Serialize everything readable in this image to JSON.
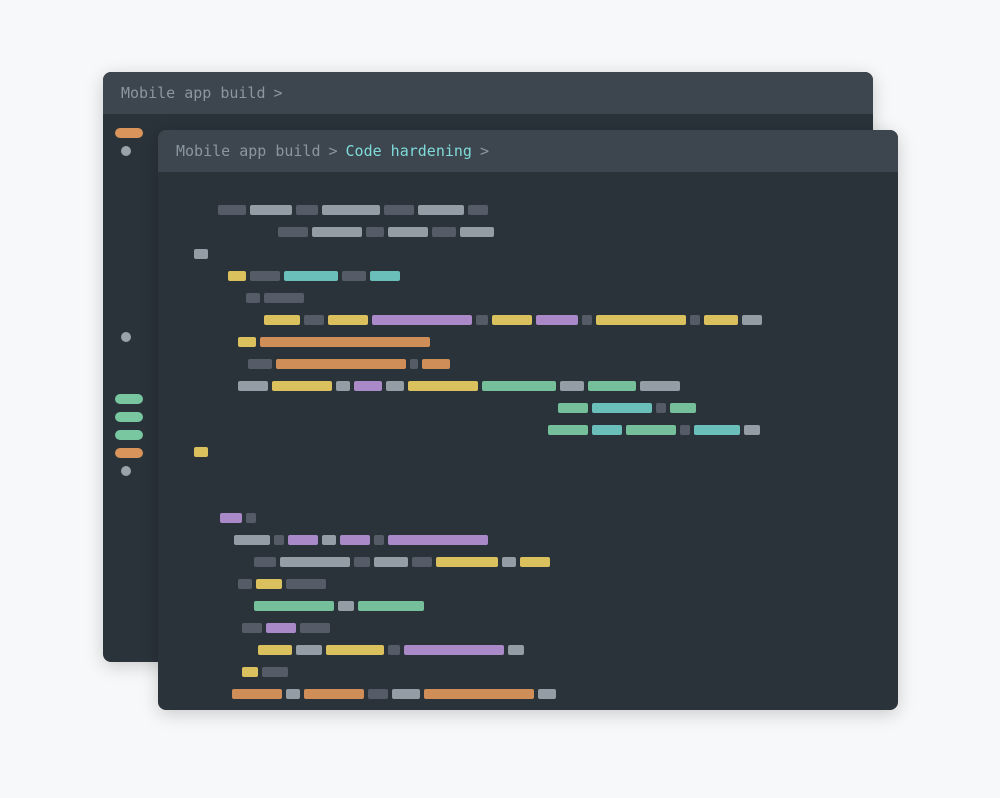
{
  "back_window": {
    "breadcrumb": [
      {
        "label": "Mobile app build",
        "active": false
      }
    ],
    "gutter": [
      {
        "kind": "pill",
        "color": "c-orange"
      },
      {
        "kind": "dot",
        "color": "c-lgray"
      },
      {
        "kind": "gap",
        "h": 160
      },
      {
        "kind": "dot",
        "color": "c-lgray"
      },
      {
        "kind": "gap",
        "h": 36
      },
      {
        "kind": "pill",
        "color": "c-green"
      },
      {
        "kind": "pill",
        "color": "c-green"
      },
      {
        "kind": "pill",
        "color": "c-green"
      },
      {
        "kind": "pill",
        "color": "c-orange"
      },
      {
        "kind": "dot",
        "color": "c-lgray"
      }
    ]
  },
  "front_window": {
    "breadcrumb": [
      {
        "label": "Mobile app build",
        "active": false
      },
      {
        "label": "Code hardening",
        "active": true
      }
    ],
    "code_rows": [
      {
        "indent": 20,
        "tokens": [
          [
            "c-gray",
            28
          ],
          [
            "c-lgray",
            42
          ],
          [
            "c-gray",
            22
          ],
          [
            "c-lgray",
            58
          ],
          [
            "c-gray",
            30
          ],
          [
            "c-lgray",
            46
          ],
          [
            "c-gray",
            20
          ]
        ]
      },
      {
        "indent": 80,
        "tokens": [
          [
            "c-gray",
            30
          ],
          [
            "c-lgray",
            50
          ],
          [
            "c-gray",
            18
          ],
          [
            "c-lgray",
            40
          ],
          [
            "c-gray",
            24
          ],
          [
            "c-lgray",
            34
          ]
        ]
      },
      {
        "indent": 0,
        "tokens": [
          [
            "c-lgray",
            14
          ]
        ]
      },
      {
        "indent": 30,
        "tokens": [
          [
            "c-yellow",
            18
          ],
          [
            "c-gray",
            30
          ],
          [
            "c-teal",
            54
          ],
          [
            "c-gray",
            24
          ],
          [
            "c-teal",
            30
          ]
        ]
      },
      {
        "indent": 48,
        "tokens": [
          [
            "c-gray",
            14
          ],
          [
            "c-gray",
            40
          ]
        ]
      },
      {
        "indent": 66,
        "tokens": [
          [
            "c-yellow",
            36
          ],
          [
            "c-gray",
            20
          ],
          [
            "c-yellow",
            40
          ],
          [
            "c-purple",
            100
          ],
          [
            "c-gray",
            12
          ],
          [
            "c-yellow",
            40
          ],
          [
            "c-purple",
            42
          ],
          [
            "c-gray",
            10
          ],
          [
            "c-yellow",
            90
          ],
          [
            "c-gray",
            10
          ],
          [
            "c-yellow",
            34
          ],
          [
            "c-lgray",
            20
          ]
        ]
      },
      {
        "indent": 40,
        "tokens": [
          [
            "c-yellow",
            18
          ],
          [
            "c-orange",
            170
          ]
        ]
      },
      {
        "indent": 50,
        "tokens": [
          [
            "c-gray",
            24
          ],
          [
            "c-orange",
            130
          ],
          [
            "c-gray",
            8
          ],
          [
            "c-orange",
            28
          ]
        ]
      },
      {
        "indent": 40,
        "tokens": [
          [
            "c-lgray",
            30
          ],
          [
            "c-yellow",
            60
          ],
          [
            "c-lgray",
            14
          ],
          [
            "c-purple",
            28
          ],
          [
            "c-lgray",
            18
          ],
          [
            "c-yellow",
            70
          ],
          [
            "c-green",
            74
          ],
          [
            "c-lgray",
            24
          ],
          [
            "c-green",
            48
          ],
          [
            "c-lgray",
            40
          ]
        ]
      },
      {
        "indent": 360,
        "tokens": [
          [
            "c-green",
            30
          ],
          [
            "c-teal",
            60
          ],
          [
            "c-gray",
            10
          ],
          [
            "c-green",
            26
          ]
        ]
      },
      {
        "indent": 350,
        "tokens": [
          [
            "c-green",
            40
          ],
          [
            "c-teal",
            30
          ],
          [
            "c-green",
            50
          ],
          [
            "c-gray",
            10
          ],
          [
            "c-teal",
            46
          ],
          [
            "c-lgray",
            16
          ]
        ]
      },
      {
        "indent": 0,
        "tokens": [
          [
            "c-yellow",
            14
          ]
        ]
      },
      {
        "indent": 0,
        "tokens": []
      },
      {
        "indent": 0,
        "tokens": []
      },
      {
        "indent": 22,
        "tokens": [
          [
            "c-purple",
            22
          ],
          [
            "c-gray",
            10
          ]
        ]
      },
      {
        "indent": 36,
        "tokens": [
          [
            "c-lgray",
            36
          ],
          [
            "c-gray",
            10
          ],
          [
            "c-purple",
            30
          ],
          [
            "c-lgray",
            14
          ],
          [
            "c-purple",
            30
          ],
          [
            "c-gray",
            10
          ],
          [
            "c-purple",
            100
          ]
        ]
      },
      {
        "indent": 56,
        "tokens": [
          [
            "c-gray",
            22
          ],
          [
            "c-lgray",
            70
          ],
          [
            "c-gray",
            16
          ],
          [
            "c-lgray",
            34
          ],
          [
            "c-gray",
            20
          ],
          [
            "c-yellow",
            62
          ],
          [
            "c-lgray",
            14
          ],
          [
            "c-yellow",
            30
          ]
        ]
      },
      {
        "indent": 40,
        "tokens": [
          [
            "c-gray",
            14
          ],
          [
            "c-yellow",
            26
          ],
          [
            "c-gray",
            40
          ]
        ]
      },
      {
        "indent": 56,
        "tokens": [
          [
            "c-green",
            80
          ],
          [
            "c-lgray",
            16
          ],
          [
            "c-green",
            66
          ]
        ]
      },
      {
        "indent": 44,
        "tokens": [
          [
            "c-gray",
            20
          ],
          [
            "c-purple",
            30
          ],
          [
            "c-gray",
            30
          ]
        ]
      },
      {
        "indent": 60,
        "tokens": [
          [
            "c-yellow",
            34
          ],
          [
            "c-lgray",
            26
          ],
          [
            "c-yellow",
            58
          ],
          [
            "c-gray",
            12
          ],
          [
            "c-purple",
            100
          ],
          [
            "c-lgray",
            16
          ]
        ]
      },
      {
        "indent": 44,
        "tokens": [
          [
            "c-yellow",
            16
          ],
          [
            "c-gray",
            26
          ]
        ]
      },
      {
        "indent": 34,
        "tokens": [
          [
            "c-orange",
            50
          ],
          [
            "c-lgray",
            14
          ],
          [
            "c-orange",
            60
          ],
          [
            "c-gray",
            20
          ],
          [
            "c-lgray",
            28
          ],
          [
            "c-orange",
            110
          ],
          [
            "c-lgray",
            18
          ]
        ]
      },
      {
        "indent": 40,
        "tokens": [
          [
            "c-gray",
            20
          ],
          [
            "c-yellow",
            60
          ],
          [
            "c-purple",
            28
          ],
          [
            "c-lgray",
            22
          ],
          [
            "c-yellow",
            38
          ],
          [
            "c-green",
            70
          ],
          [
            "c-lgray",
            18
          ],
          [
            "c-green",
            62
          ],
          [
            "c-lgray",
            40
          ],
          [
            "c-gray",
            16
          ]
        ]
      },
      {
        "indent": 350,
        "tokens": [
          [
            "c-green",
            46
          ],
          [
            "c-teal",
            34
          ],
          [
            "c-gray",
            14
          ],
          [
            "c-green",
            38
          ]
        ]
      },
      {
        "indent": 340,
        "tokens": [
          [
            "c-green",
            30
          ],
          [
            "c-teal",
            24
          ],
          [
            "c-green",
            40
          ],
          [
            "c-gray",
            12
          ],
          [
            "c-teal",
            44
          ],
          [
            "c-lgray",
            16
          ]
        ]
      }
    ]
  }
}
